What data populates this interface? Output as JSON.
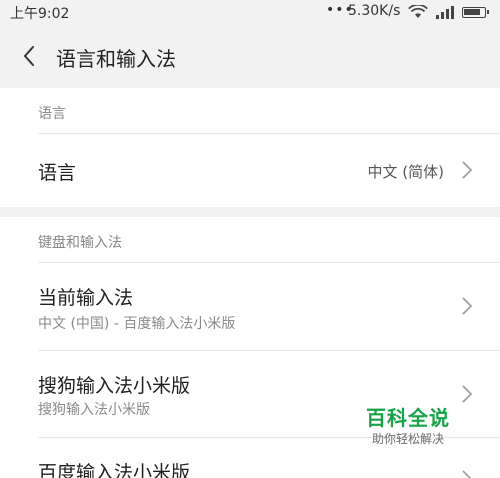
{
  "status_bar": {
    "time": "上午9:02",
    "dots": "•••",
    "network_speed": "5.30K/s",
    "wifi_icon": "wifi-icon",
    "signal_icon": "cellular-signal-icon",
    "battery_icon": "battery-icon",
    "battery_level": 0.85
  },
  "header": {
    "back_icon": "chevron-left-icon",
    "title": "语言和输入法"
  },
  "sections": {
    "language": {
      "label": "语言",
      "row": {
        "title": "语言",
        "value": "中文 (简体)"
      }
    },
    "keyboard": {
      "label": "键盘和输入法",
      "rows": [
        {
          "title": "当前输入法",
          "subtitle": "中文 (中国) - 百度输入法小米版"
        },
        {
          "title": "搜狗输入法小米版",
          "subtitle": "搜狗输入法小米版"
        },
        {
          "title": "百度输入法小米版"
        }
      ]
    }
  },
  "watermark": {
    "title": "百科全说",
    "subtitle": "助你轻松解决"
  },
  "colors": {
    "background": "#ffffff",
    "header_bg": "#f2f2f2",
    "section_label": "#888888",
    "watermark_green": "#17a348"
  }
}
